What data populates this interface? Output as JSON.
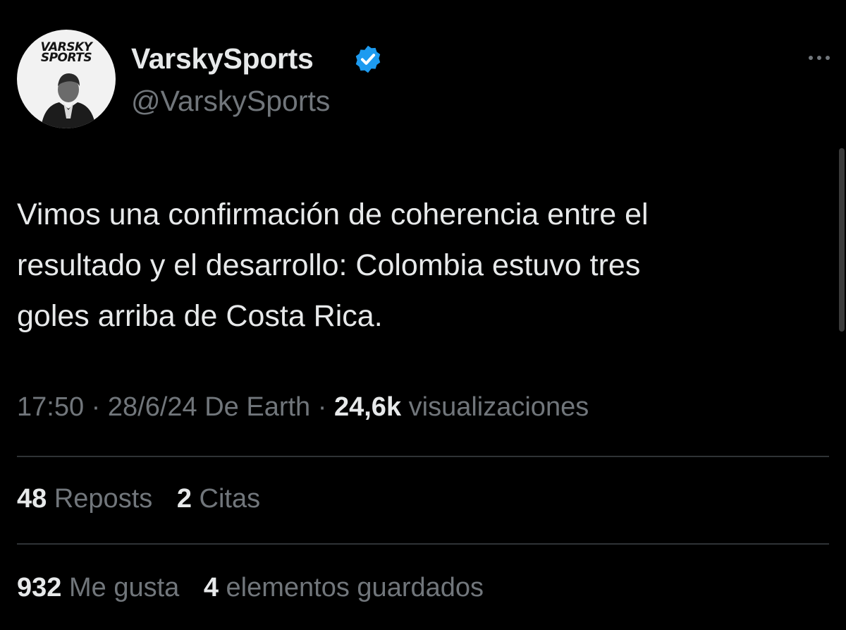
{
  "author": {
    "avatar_logo_line1": "VARSKY",
    "avatar_logo_line2": "SPORTS",
    "display_name": "VarskySports",
    "handle": "@VarskySports",
    "verified_icon": "verified-badge-icon",
    "verified_color": "#1d9bf0"
  },
  "tweet": {
    "lines": [
      "Vimos una confirmación de coherencia entre el",
      "resultado y el desarrollo: Colombia estuvo tres",
      "goles arriba de Costa Rica."
    ]
  },
  "meta": {
    "time": "17:50",
    "separator": " · ",
    "date": "28/6/24",
    "source": "De Earth",
    "views_count": "24,6k",
    "views_label": "visualizaciones"
  },
  "stats_row1": {
    "reposts_count": "48",
    "reposts_label": "Reposts",
    "quotes_count": "2",
    "quotes_label": "Citas"
  },
  "stats_row2": {
    "likes_count": "932",
    "likes_label": "Me gusta",
    "bookmarks_count": "4",
    "bookmarks_label": "elementos guardados"
  },
  "colors": {
    "background": "#000000",
    "text_primary": "#e7e9ea",
    "text_secondary": "#71767b",
    "divider": "#2f3336"
  },
  "icons": {
    "more": "more-options-icon"
  }
}
